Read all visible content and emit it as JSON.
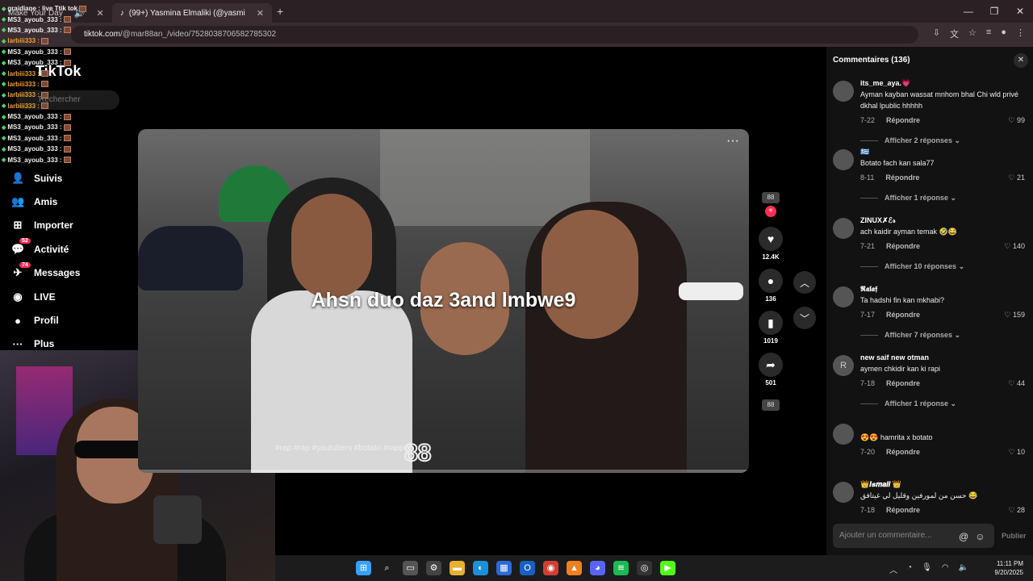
{
  "browser": {
    "tabs": [
      {
        "label": "Make Your Day",
        "active": false
      },
      {
        "label": "(99+) Yasmina Elmaliki (@yasmi",
        "active": true
      }
    ],
    "new_tab": "+",
    "url_host": "tiktok.com",
    "url_path": "/@mar88an_/video/7528038706582785302"
  },
  "chat": [
    {
      "user": "graidiane : live Ttik tok",
      "style": "u1"
    },
    {
      "user": "MS3_ayoub_333 :",
      "style": "u1"
    },
    {
      "user": "MS3_ayoub_333 :",
      "style": "u1"
    },
    {
      "user": "larbiii333 :",
      "style": "u2"
    },
    {
      "user": "MS3_ayoub_333 :",
      "style": "u1"
    },
    {
      "user": "MS3_ayoub_333 :",
      "style": "u1"
    },
    {
      "user": "larbiii333 :",
      "style": "u2"
    },
    {
      "user": "larbiii333 :",
      "style": "u2"
    },
    {
      "user": "larbiii333 :",
      "style": "u2"
    },
    {
      "user": "larbiii333 :",
      "style": "u2"
    },
    {
      "user": "MS3_ayoub_333 :",
      "style": "u1"
    },
    {
      "user": "MS3_ayoub_333 :",
      "style": "u1"
    },
    {
      "user": "MS3_ayoub_333 :",
      "style": "u1"
    },
    {
      "user": "MS3_ayoub_333 :",
      "style": "u1"
    },
    {
      "user": "MS3_ayoub_333 :",
      "style": "u1"
    }
  ],
  "tiktok": {
    "logo": "TikTok",
    "search_placeholder": "Rechercher",
    "nav": [
      {
        "label": "Suivis",
        "icon": "user-icon",
        "glyph": "👤",
        "badge": ""
      },
      {
        "label": "Amis",
        "icon": "friends-icon",
        "glyph": "👥",
        "badge": ""
      },
      {
        "label": "Importer",
        "icon": "upload-icon",
        "glyph": "⊞",
        "badge": ""
      },
      {
        "label": "Activité",
        "icon": "activity-icon",
        "glyph": "💬",
        "badge": "52"
      },
      {
        "label": "Messages",
        "icon": "messages-icon",
        "glyph": "✈",
        "badge": "74"
      },
      {
        "label": "LIVE",
        "icon": "live-icon",
        "glyph": "◉",
        "badge": ""
      },
      {
        "label": "Profil",
        "icon": "profile-icon",
        "glyph": "●",
        "badge": ""
      },
      {
        "label": "Plus",
        "icon": "more-icon",
        "glyph": "···",
        "badge": ""
      }
    ]
  },
  "video": {
    "caption": "Ahsn duo daz 3and lmbwe9",
    "hashtags": "#rap #rap #youtubers #botato #rapper",
    "watermark": "88",
    "more": "···"
  },
  "actions": {
    "avatar_tag": "88",
    "likes": "12.4K",
    "comments": "136",
    "saves": "1019",
    "shares": "501"
  },
  "comments_panel": {
    "title": "Commentaires (136)",
    "input_placeholder": "Ajouter un commentaire...",
    "publish": "Publier",
    "reply_label": "Répondre",
    "items": [
      {
        "user": "its_me_aya.💗",
        "text": "Ayman kayban wassat mnhom bhal Chi wld privé dkhal lpublic hhhhh",
        "date": "7-22",
        "likes": "99",
        "more": "Afficher 2 réponses",
        "avatar": ""
      },
      {
        "user": "🇬🇷",
        "text": "Botato fach kan sala77",
        "date": "8-11",
        "likes": "21",
        "more": "Afficher 1 réponse",
        "avatar": ""
      },
      {
        "user": "ZINUX✗ℰ𝓇",
        "text": "ach kaidir ayman temak 🤣😂",
        "date": "7-21",
        "likes": "140",
        "more": "Afficher 10 réponses",
        "avatar": ""
      },
      {
        "user": "𝕽𝖆𝖑𝖆𝖋",
        "text": "Ta hadshi fin kan mkhabi?",
        "date": "7-17",
        "likes": "159",
        "more": "Afficher 7 réponses",
        "avatar": ""
      },
      {
        "user": "new saif new otman",
        "text": "aymen chkidir kan ki rapi",
        "date": "7-18",
        "likes": "44",
        "more": "Afficher 1 réponse",
        "avatar": "R"
      },
      {
        "user": "ﾠ",
        "text": "😍😍 hamrita x botato",
        "date": "7-20",
        "likes": "10",
        "more": "",
        "avatar": ""
      },
      {
        "user": "👑𝑰𝒔𝒎𝒂𝒊𝒍 👑",
        "text": "حسن من لمورفين وقليل لي غيتافق 😂",
        "date": "7-18",
        "likes": "28",
        "more": "",
        "avatar": ""
      }
    ]
  },
  "taskbar": {
    "time": "11:11 PM",
    "date": "9/20/2025",
    "apps": [
      {
        "name": "windows-start-icon",
        "glyph": "⊞",
        "color": "#3aa0ff"
      },
      {
        "name": "search-icon",
        "glyph": "⌕",
        "color": "#1c1c1c"
      },
      {
        "name": "task-view-icon",
        "glyph": "▭",
        "color": "#555"
      },
      {
        "name": "settings-icon",
        "glyph": "⚙",
        "color": "#444"
      },
      {
        "name": "file-explorer-icon",
        "glyph": "▬",
        "color": "#e8b030"
      },
      {
        "name": "edge-icon",
        "glyph": "◐",
        "color": "#1d8fd8"
      },
      {
        "name": "store-icon",
        "glyph": "▦",
        "color": "#2a6ad8"
      },
      {
        "name": "outlook-icon",
        "glyph": "O",
        "color": "#1a5fc0"
      },
      {
        "name": "chrome-icon",
        "glyph": "◉",
        "color": "#d04030"
      },
      {
        "name": "vlc-icon",
        "glyph": "▲",
        "color": "#f08020"
      },
      {
        "name": "discord-icon",
        "glyph": "◕",
        "color": "#5865f2"
      },
      {
        "name": "spotify-icon",
        "glyph": "≋",
        "color": "#1db954"
      },
      {
        "name": "obs-icon",
        "glyph": "◎",
        "color": "#333"
      },
      {
        "name": "kick-icon",
        "glyph": "▶",
        "color": "#53fc18"
      }
    ]
  }
}
